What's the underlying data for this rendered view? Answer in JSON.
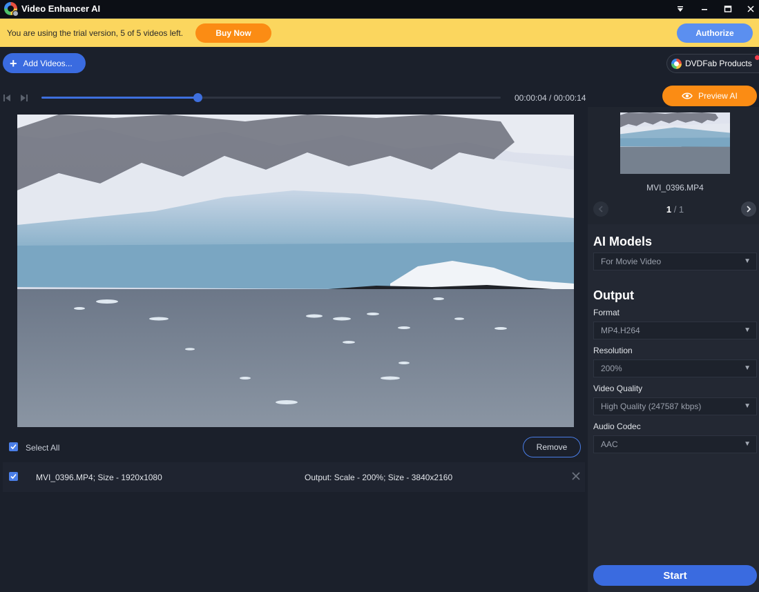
{
  "window": {
    "title": "Video Enhancer AI"
  },
  "banner": {
    "message": "You are using the trial version, 5 of 5 videos left.",
    "buy_now_label": "Buy Now",
    "authorize_label": "Authorize"
  },
  "toolbar": {
    "add_videos_label": "Add Videos...",
    "dvdfab_products_label": "DVDFab Products"
  },
  "player": {
    "time_readout": "00:00:04 / 00:00:14",
    "progress_fraction": 0.34,
    "preview_ai_label": "Preview AI"
  },
  "list": {
    "select_all_label": "Select All",
    "remove_label": "Remove",
    "items": [
      {
        "name": "MVI_0396.MP4; Size - 1920x1080",
        "output": "Output: Scale - 200%; Size - 3840x2160",
        "checked": true
      }
    ]
  },
  "panel": {
    "thumbnail_name": "MVI_0396.MP4",
    "pager": {
      "current": "1",
      "total": " / 1"
    },
    "ai_models_title": "AI Models",
    "ai_model_value": "For Movie Video",
    "output_title": "Output",
    "format_label": "Format",
    "format_value": "MP4.H264",
    "resolution_label": "Resolution",
    "resolution_value": "200%",
    "quality_label": "Video Quality",
    "quality_value": "High Quality (247587 kbps)",
    "audio_label": "Audio Codec",
    "audio_value": "AAC",
    "start_label": "Start"
  },
  "colors": {
    "accent_blue": "#3a6be0",
    "accent_orange": "#fb8c14",
    "banner_yellow": "#fbd65e"
  }
}
